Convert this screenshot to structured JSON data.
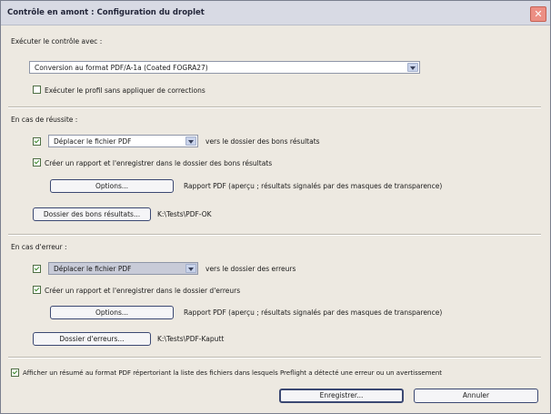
{
  "window": {
    "title": "Contrôle en amont : Configuration du droplet",
    "close_glyph": "✕"
  },
  "execute": {
    "section_label": "Exécuter le contrôle avec :",
    "profile_value": "Conversion au format PDF/A-1a (Coated FOGRA27)",
    "no_fix_checked": false,
    "no_fix_label": "Exécuter le profil sans appliquer de corrections"
  },
  "success": {
    "section_label": "En cas de réussite :",
    "move_checked": true,
    "move_action": "Déplacer le fichier PDF",
    "move_suffix": "vers le dossier des bons résultats",
    "report_checked": true,
    "report_label": "Créer un rapport et l'enregistrer dans le dossier des bons résultats",
    "options_label": "Options...",
    "options_desc": "Rapport PDF (aperçu ; résultats signalés par des masques de transparence)",
    "folder_button": "Dossier des bons résultats...",
    "folder_path": "K:\\Tests\\PDF-OK"
  },
  "error": {
    "section_label": "En cas d'erreur :",
    "move_checked": true,
    "move_action": "Déplacer le fichier PDF",
    "move_suffix": "vers le dossier des erreurs",
    "report_checked": true,
    "report_label": "Créer un rapport et l'enregistrer dans le dossier d'erreurs",
    "options_label": "Options...",
    "options_desc": "Rapport PDF (aperçu ; résultats signalés par des masques de transparence)",
    "folder_button": "Dossier d'erreurs...",
    "folder_path": "K:\\Tests\\PDF-Kaputt"
  },
  "summary": {
    "checked": true,
    "label": "Afficher un résumé au format PDF répertoriant la liste des fichiers dans lesquels Preflight a détecté une erreur ou un avertissement"
  },
  "footer": {
    "save_label": "Enregistrer...",
    "cancel_label": "Annuler"
  }
}
